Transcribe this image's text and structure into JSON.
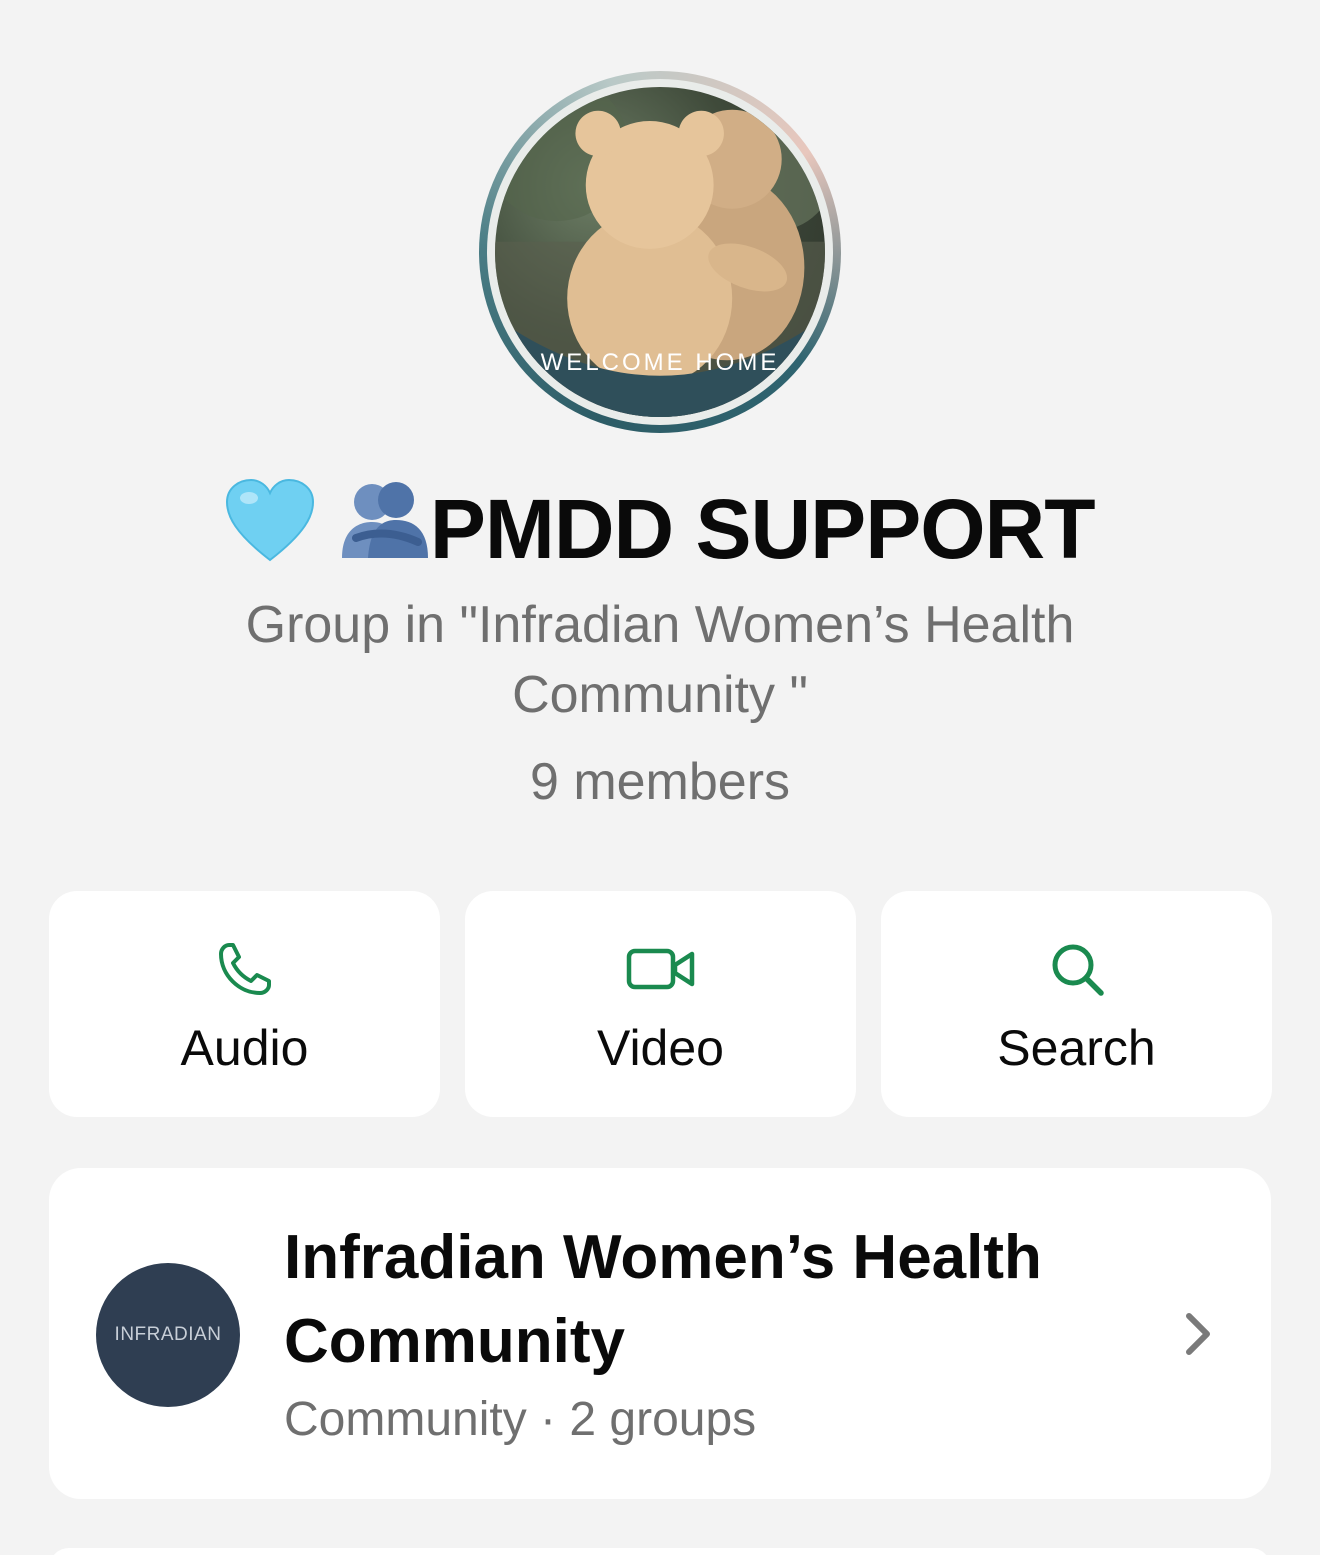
{
  "group": {
    "avatar_caption": "WELCOME HOME",
    "title": "PMDD SUPPORT",
    "subtitle": "Group in \"Infradian Women’s Health Community \"",
    "members": "9 members"
  },
  "actions": [
    {
      "label": "Audio",
      "icon": "phone-icon"
    },
    {
      "label": "Video",
      "icon": "video-camera-icon"
    },
    {
      "label": "Search",
      "icon": "search-icon"
    }
  ],
  "community": {
    "logo_text": "INFRADIAN",
    "name": "Infradian Women’s Health Community",
    "meta": "Community · 2 groups"
  },
  "colors": {
    "accent": "#1a8a4f",
    "background": "#f3f3f3",
    "logo_bg": "#2f3e52"
  }
}
